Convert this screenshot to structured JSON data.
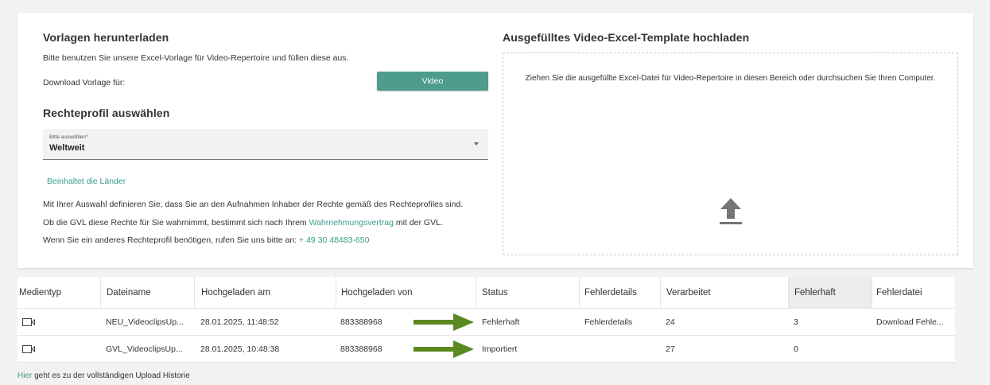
{
  "download": {
    "title": "Vorlagen herunterladen",
    "description": "Bitte benutzen Sie unsere Excel-Vorlage für Video-Repertoire und füllen diese aus.",
    "template_label": "Download Vorlage für:",
    "video_button": "Video"
  },
  "profile": {
    "title": "Rechteprofil auswählen",
    "select_label": "Bitte auswählen*",
    "select_value": "Weltweit",
    "countries_link": "Beinhaltet die Länder",
    "info_line1": "Mit Ihrer Auswahl definieren Sie, dass Sie an den Aufnahmen Inhaber der Rechte gemäß des Rechteprofiles sind.",
    "info_line2_pre": "Ob die GVL diese Rechte für Sie wahrnimmt, bestimmt sich nach Ihrem ",
    "info_line2_link": "Wahrnehmungsvertrag",
    "info_line2_post": " mit der GVL.",
    "info_line3_pre": "Wenn Sie ein anderes Rechteprofil benötigen, rufen Sie uns bitte an: ",
    "info_line3_phone": "+ 49 30 48483-650"
  },
  "upload": {
    "title": "Ausgefülltes Video-Excel-Template hochladen",
    "dropzone_text": "Ziehen Sie die ausgefüllte Excel-Datei für Video-Repertoire in diesen Bereich oder durchsuchen Sie Ihren Computer.",
    "icon": "upload-icon"
  },
  "table": {
    "headers": [
      "Medientyp",
      "Dateiname",
      "Hochgeladen am",
      "Hochgeladen von",
      "Status",
      "Fehlerdetails",
      "Verarbeitet",
      "Fehlerhaft",
      "Fehlerdatei"
    ],
    "rows": [
      {
        "media_icon": "video-camera-icon",
        "filename": "NEU_VideoclipsUp...",
        "uploaded_at": "28.01.2025, 11:48:52",
        "uploaded_by": "883388968",
        "status": "Fehlerhaft",
        "error_details": "Fehlerdetails",
        "processed": "24",
        "faulty": "3",
        "error_file": "Download Fehle..."
      },
      {
        "media_icon": "video-camera-icon",
        "filename": "GVL_VideoclipsUp...",
        "uploaded_at": "28.01.2025, 10:48:38",
        "uploaded_by": "883388968",
        "status": "Importiert",
        "error_details": "",
        "processed": "27",
        "faulty": "0",
        "error_file": ""
      }
    ]
  },
  "footer": {
    "link": "Hier",
    "text": " geht es zu der vollständigen Upload Historie"
  },
  "colors": {
    "accent": "#4e9c8b",
    "link": "#3a9c8c",
    "arrow": "#5a8a1f"
  }
}
